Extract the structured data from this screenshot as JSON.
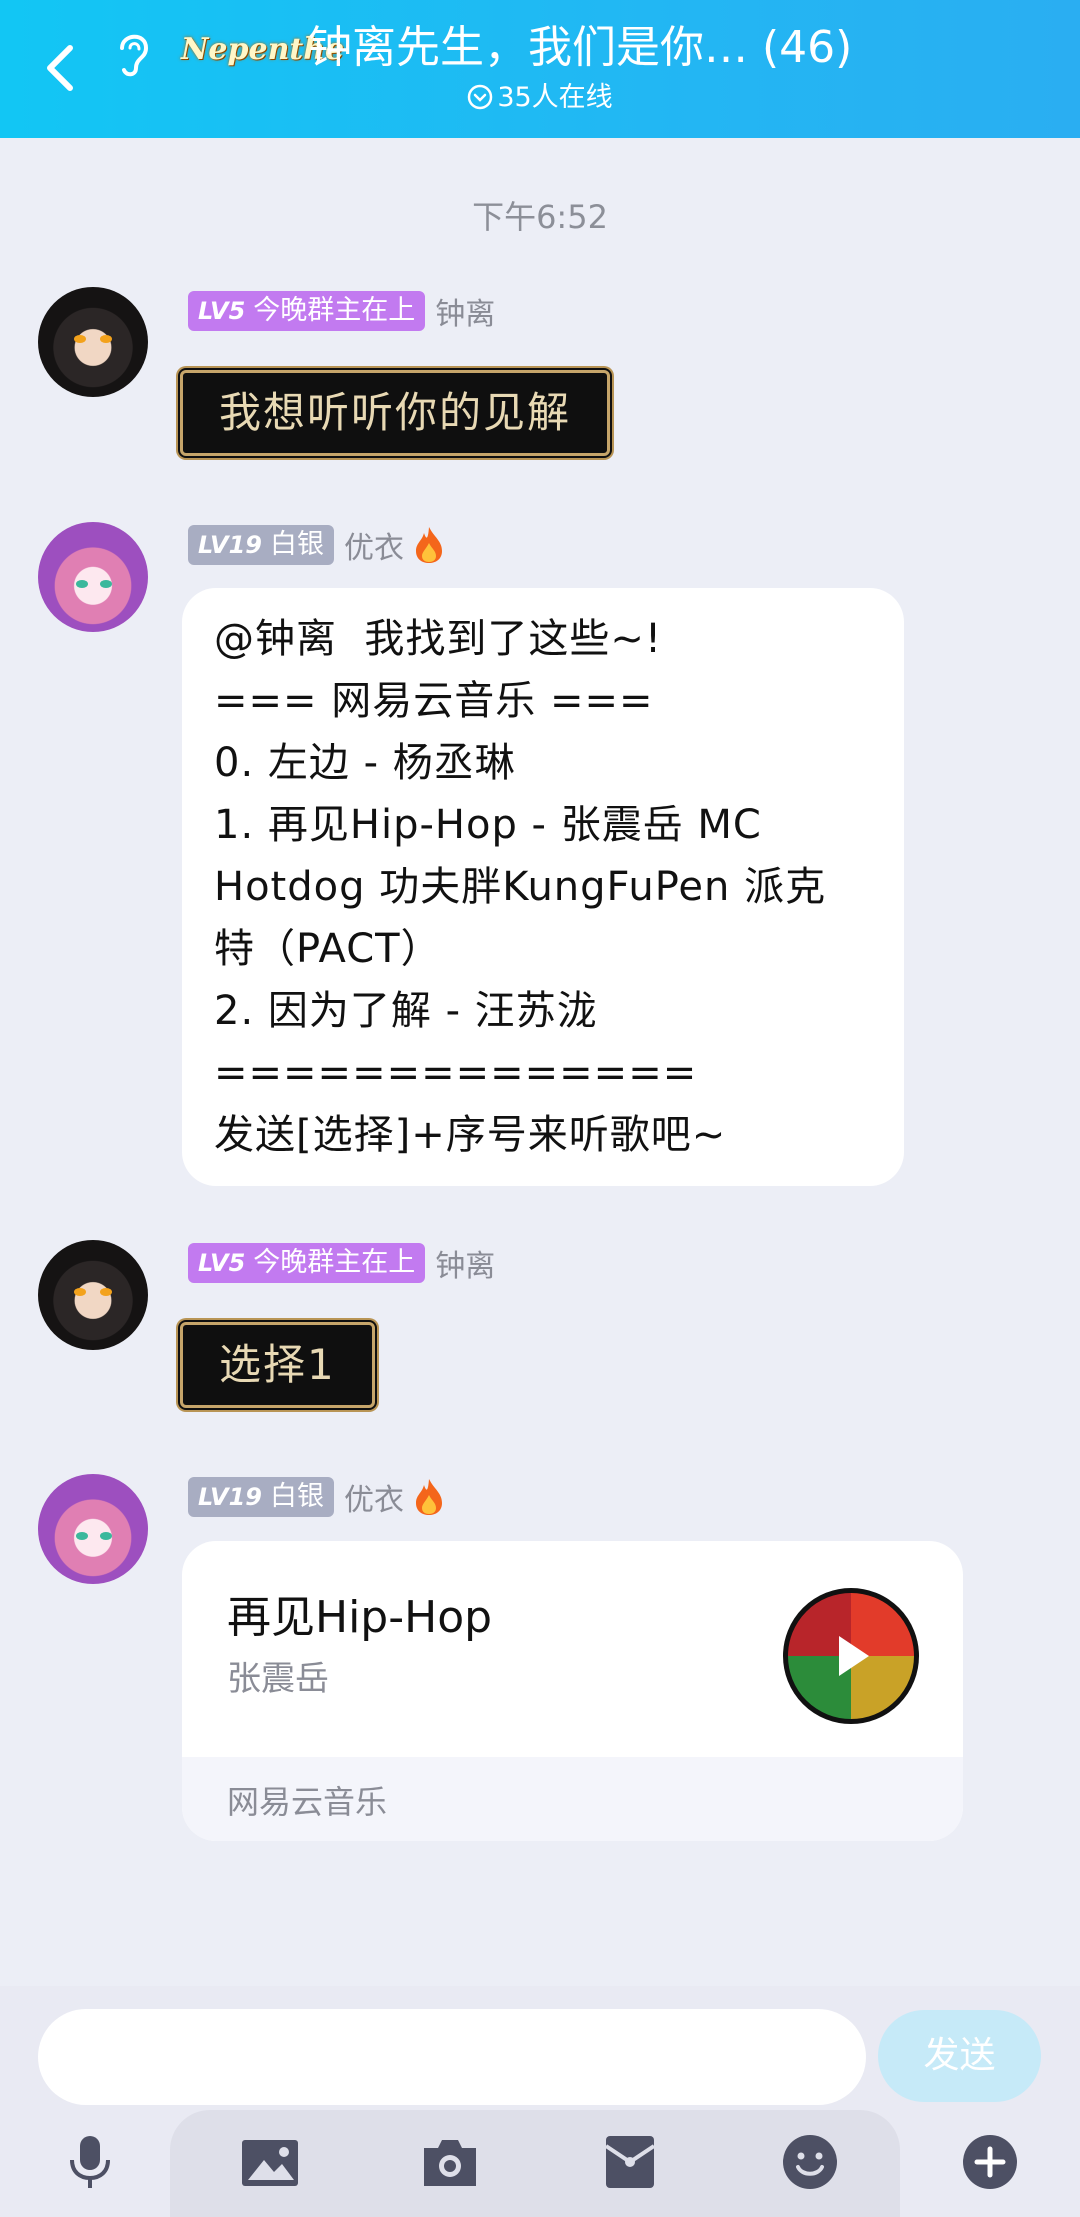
{
  "header": {
    "brand": "Nepenthe",
    "title": "钟离先生，我们是你… (46)",
    "online": "35人在线"
  },
  "timestamp": "下午6:52",
  "messages": [
    {
      "level": "LV5",
      "tag": "今晚群主在上",
      "sender": "钟离",
      "text": "我想听听你的见解"
    },
    {
      "level": "LV19",
      "tag": "白银",
      "sender": "优衣",
      "lines": [
        "@钟离  我找到了这些~!",
        "=== 网易云音乐 ===",
        "0. 左边 - 杨丞琳",
        "1. 再见Hip-Hop - 张震岳 MC",
        "Hotdog 功夫胖KungFuPen 派克",
        "特（PACT）",
        "2. 因为了解 - 汪苏泷",
        "==============",
        "发送[选择]+序号来听歌吧~"
      ]
    },
    {
      "level": "LV5",
      "tag": "今晚群主在上",
      "sender": "钟离",
      "text": "选择1"
    },
    {
      "level": "LV19",
      "tag": "白银",
      "sender": "优衣",
      "card": {
        "song": "再见Hip-Hop",
        "artist": "张震岳",
        "source": "网易云音乐"
      }
    }
  ],
  "input": {
    "placeholder": "",
    "send": "发送"
  },
  "toolbar": [
    "mic-icon",
    "image-icon",
    "camera-icon",
    "red-packet-icon",
    "emoji-icon",
    "plus-icon"
  ],
  "colors": {
    "header": "#1fbdf4",
    "lv5_tag": "#c27af0",
    "lv19_tag": "#a8adc2",
    "send_disabled": "#c6eaf8"
  }
}
